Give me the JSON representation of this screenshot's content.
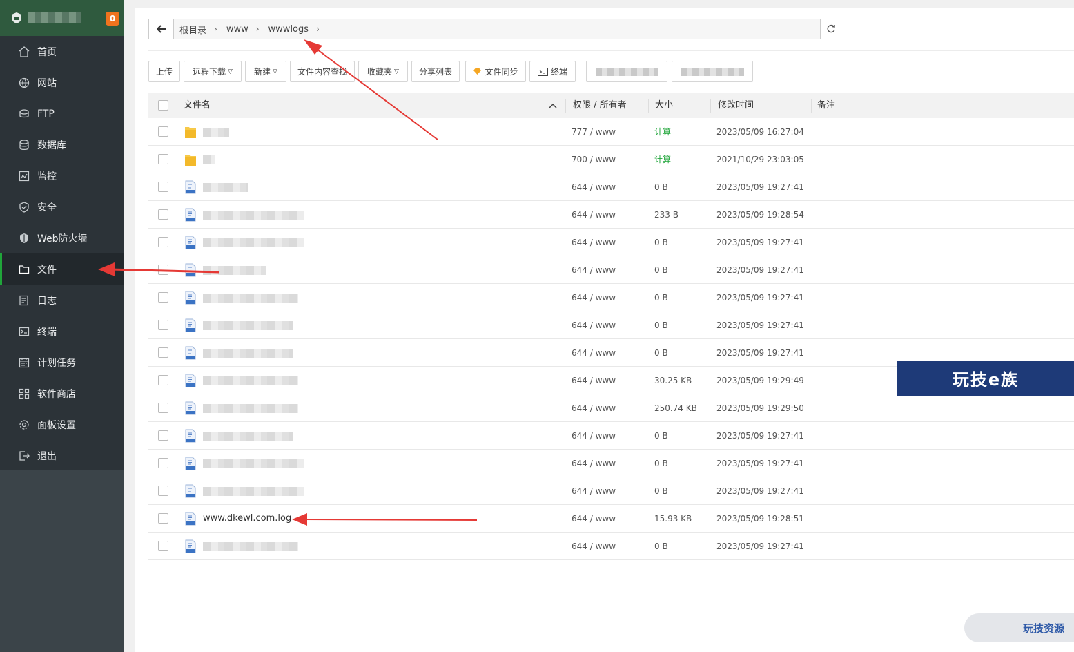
{
  "sidebar": {
    "badge": "0",
    "items": [
      {
        "label": "首页",
        "icon": "home-icon"
      },
      {
        "label": "网站",
        "icon": "globe-icon"
      },
      {
        "label": "FTP",
        "icon": "ftp-icon"
      },
      {
        "label": "数据库",
        "icon": "database-icon"
      },
      {
        "label": "监控",
        "icon": "monitor-icon"
      },
      {
        "label": "安全",
        "icon": "shield-icon"
      },
      {
        "label": "Web防火墙",
        "icon": "firewall-icon"
      },
      {
        "label": "文件",
        "icon": "folder-icon",
        "active": true
      },
      {
        "label": "日志",
        "icon": "log-icon"
      },
      {
        "label": "终端",
        "icon": "terminal-icon"
      },
      {
        "label": "计划任务",
        "icon": "calendar-icon"
      },
      {
        "label": "软件商店",
        "icon": "grid-icon"
      },
      {
        "label": "面板设置",
        "icon": "gear-icon"
      },
      {
        "label": "退出",
        "icon": "logout-icon"
      }
    ]
  },
  "path": {
    "crumbs": [
      "根目录",
      "www",
      "wwwlogs"
    ]
  },
  "toolbar": {
    "upload": "上传",
    "remote_download": "远程下载",
    "new": "新建",
    "content_search": "文件内容查找",
    "favorites": "收藏夹",
    "share_list": "分享列表",
    "file_sync": "文件同步",
    "terminal": "终端"
  },
  "table": {
    "headers": {
      "name": "文件名",
      "perm": "权限 / 所有者",
      "size": "大小",
      "mtime": "修改时间",
      "note": "备注"
    },
    "rows": [
      {
        "type": "folder",
        "name": "",
        "perm": "777 / www",
        "size": "计算",
        "mtime": "2023/05/09 16:27:04"
      },
      {
        "type": "folder",
        "name": "",
        "perm": "700 / www",
        "size": "计算",
        "mtime": "2021/10/29 23:03:05"
      },
      {
        "type": "file",
        "name": "",
        "perm": "644 / www",
        "size": "0 B",
        "mtime": "2023/05/09 19:27:41"
      },
      {
        "type": "file",
        "name": "",
        "perm": "644 / www",
        "size": "233 B",
        "mtime": "2023/05/09 19:28:54"
      },
      {
        "type": "file",
        "name": "",
        "perm": "644 / www",
        "size": "0 B",
        "mtime": "2023/05/09 19:27:41"
      },
      {
        "type": "file",
        "name": "",
        "perm": "644 / www",
        "size": "0 B",
        "mtime": "2023/05/09 19:27:41"
      },
      {
        "type": "file",
        "name": "",
        "perm": "644 / www",
        "size": "0 B",
        "mtime": "2023/05/09 19:27:41"
      },
      {
        "type": "file",
        "name": "",
        "perm": "644 / www",
        "size": "0 B",
        "mtime": "2023/05/09 19:27:41"
      },
      {
        "type": "file",
        "name": "",
        "perm": "644 / www",
        "size": "0 B",
        "mtime": "2023/05/09 19:27:41"
      },
      {
        "type": "file",
        "name": "",
        "perm": "644 / www",
        "size": "30.25 KB",
        "mtime": "2023/05/09 19:29:49"
      },
      {
        "type": "file",
        "name": "",
        "perm": "644 / www",
        "size": "250.74 KB",
        "mtime": "2023/05/09 19:29:50"
      },
      {
        "type": "file",
        "name": "",
        "perm": "644 / www",
        "size": "0 B",
        "mtime": "2023/05/09 19:27:41"
      },
      {
        "type": "file",
        "name": "",
        "perm": "644 / www",
        "size": "0 B",
        "mtime": "2023/05/09 19:27:41"
      },
      {
        "type": "file",
        "name": "",
        "perm": "644 / www",
        "size": "0 B",
        "mtime": "2023/05/09 19:27:41"
      },
      {
        "type": "file",
        "name": "www.dkewl.com.log",
        "perm": "644 / www",
        "size": "15.93 KB",
        "mtime": "2023/05/09 19:28:51"
      },
      {
        "type": "file",
        "name": "",
        "perm": "644 / www",
        "size": "0 B",
        "mtime": "2023/05/09 19:27:41"
      }
    ]
  },
  "watermarks": {
    "banner": "玩技e族",
    "corner": "玩技资源"
  },
  "colors": {
    "accent_green": "#20a53a",
    "arrow_red": "#e53935",
    "sidebar_bg": "#2c3338"
  }
}
